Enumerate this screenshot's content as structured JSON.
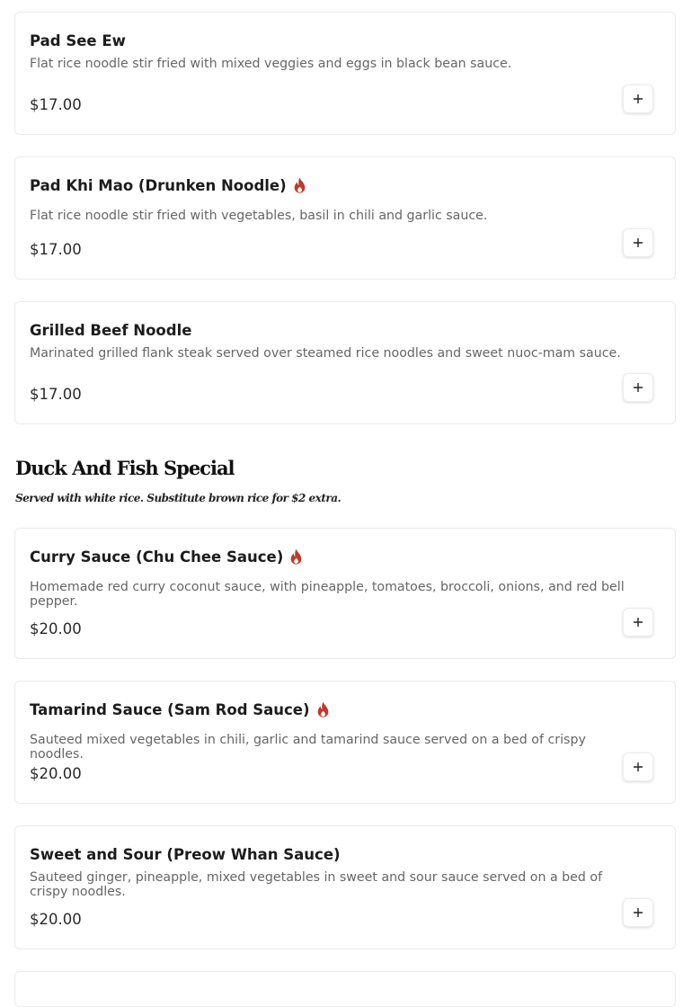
{
  "items": [
    {
      "name": "Pad See Ew",
      "spicy": false,
      "description": "Flat rice noodle stir fried with mixed veggies and eggs in black bean sauce.",
      "price": "$17.00"
    },
    {
      "name": "Pad Khi Mao (Drunken Noodle)",
      "spicy": true,
      "description": "Flat rice noodle stir fried with vegetables, basil in chili and garlic sauce.",
      "price": "$17.00"
    },
    {
      "name": "Grilled Beef Noodle",
      "spicy": false,
      "description": "Marinated grilled flank steak served over steamed rice noodles and sweet nuoc-mam sauce.",
      "price": "$17.00"
    },
    {
      "name": "Curry Sauce (Chu Chee Sauce)",
      "spicy": true,
      "description": "Homemade red curry coconut sauce, with pineapple, tomatoes, broccoli, onions, and red bell pepper.",
      "price": "$20.00"
    },
    {
      "name": "Tamarind Sauce (Sam Rod Sauce)",
      "spicy": true,
      "description": "Sauteed mixed vegetables in chili, garlic and tamarind sauce served on a bed of crispy noodles.",
      "price": "$20.00"
    },
    {
      "name": "Sweet and Sour (Preow Whan Sauce)",
      "spicy": false,
      "description": "Sauteed ginger, pineapple, mixed vegetables in sweet and sour sauce served on a bed of crispy noodles.",
      "price": "$20.00"
    }
  ],
  "section": {
    "title": "Duck And Fish Special",
    "subtitle": "Served with white rice. Substitute brown rice for $2 extra."
  },
  "colors": {
    "spicy_icon": "#c0392b",
    "border": "#ebebeb"
  },
  "icons": {
    "spicy": "fire-icon",
    "add": "plus-icon"
  }
}
